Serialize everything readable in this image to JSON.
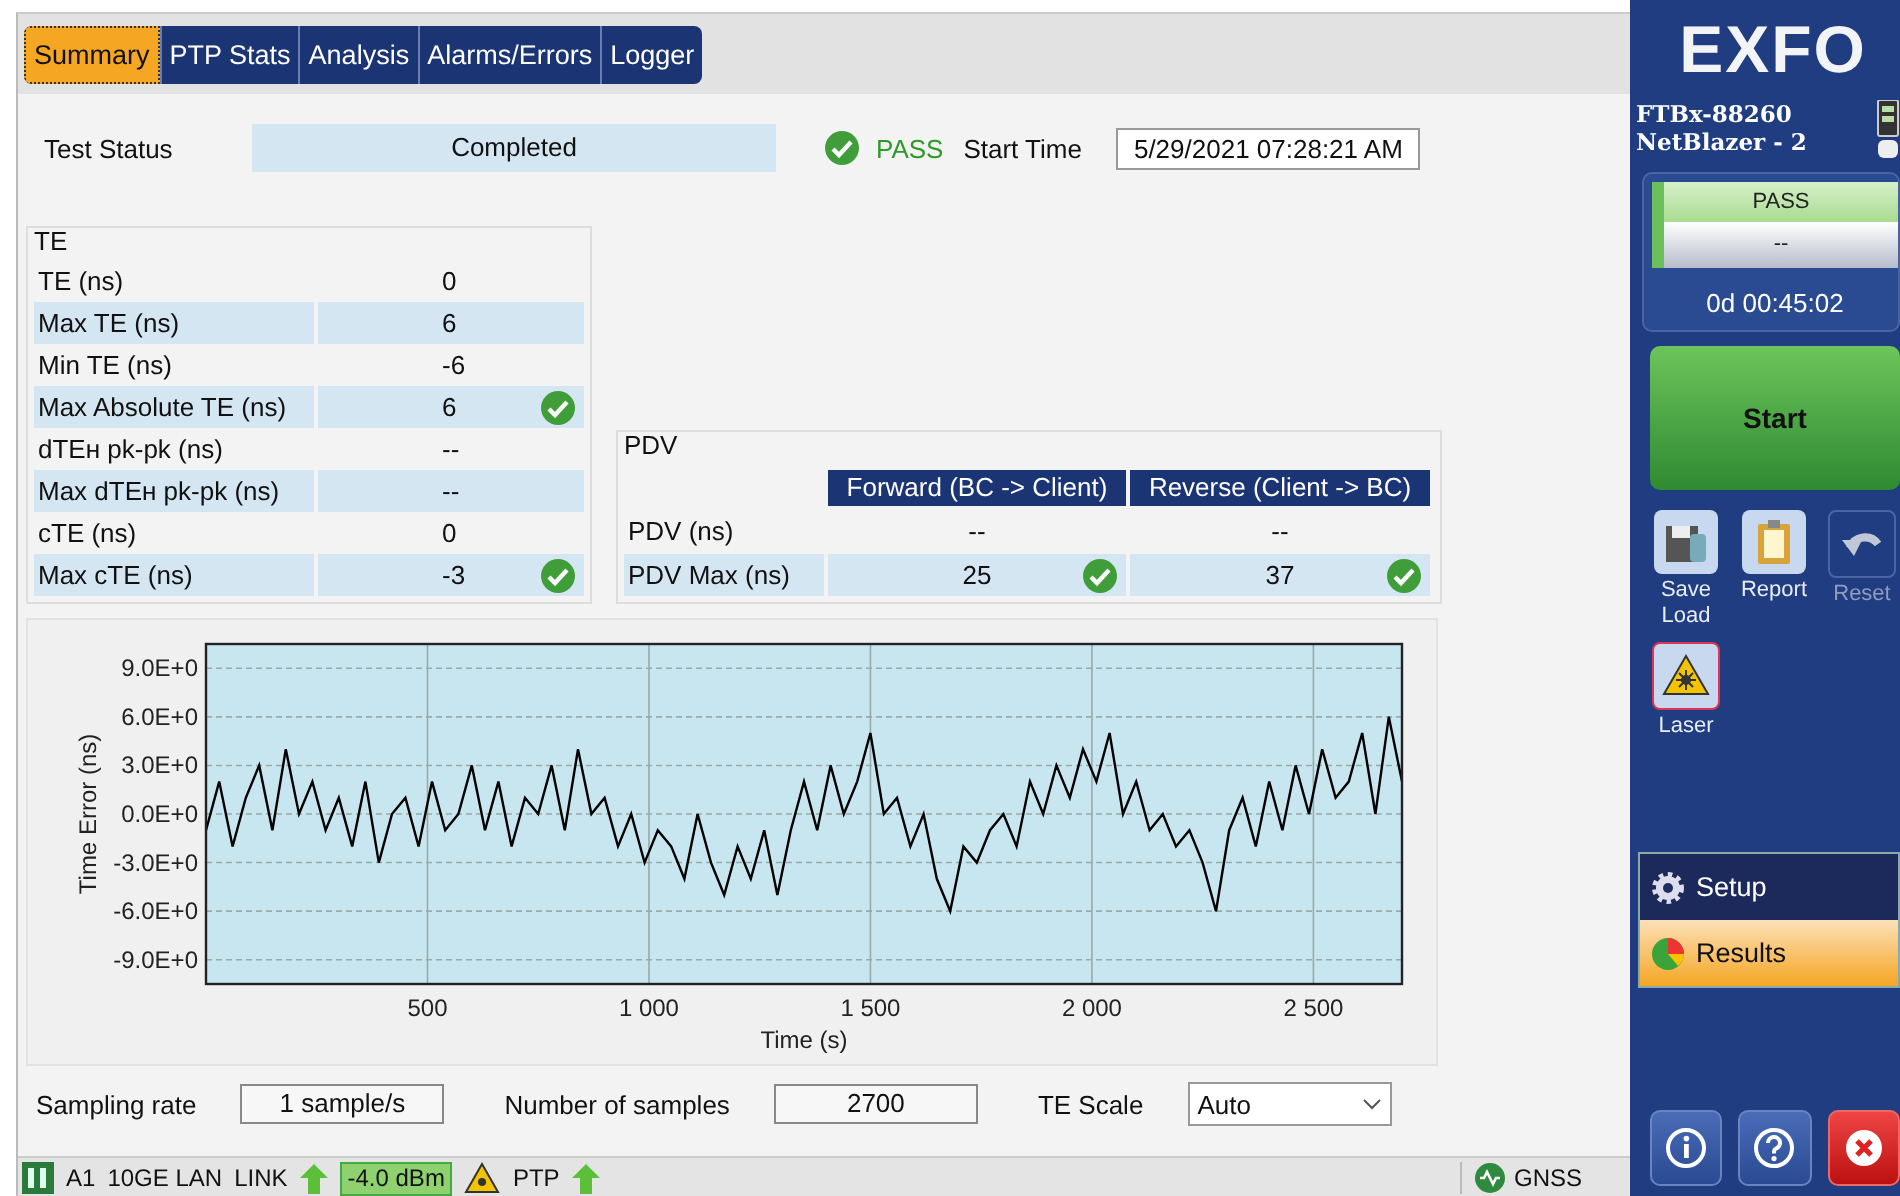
{
  "tabs": [
    {
      "label": "Summary",
      "selected": true
    },
    {
      "label": "PTP Stats",
      "selected": false
    },
    {
      "label": "Analysis",
      "selected": false
    },
    {
      "label": "Alarms/Errors",
      "selected": false
    },
    {
      "label": "Logger",
      "selected": false
    }
  ],
  "test_status": {
    "label": "Test Status",
    "value": "Completed",
    "verdict": "PASS",
    "pass": true,
    "start_time_label": "Start Time",
    "start_time": "5/29/2021 07:28:21 AM"
  },
  "te": {
    "title": "TE",
    "rows": [
      {
        "label": "TE (ns)",
        "value": "0",
        "pass": false
      },
      {
        "label": "Max TE (ns)",
        "value": "6",
        "pass": false
      },
      {
        "label": "Min TE (ns)",
        "value": "-6",
        "pass": false
      },
      {
        "label": "Max Absolute TE (ns)",
        "value": "6",
        "pass": true
      },
      {
        "label": "dTEʜ pk-pk (ns)",
        "value": "--",
        "pass": false
      },
      {
        "label": "Max dTEʜ pk-pk (ns)",
        "value": "--",
        "pass": false
      },
      {
        "label": "cTE (ns)",
        "value": "0",
        "pass": false
      },
      {
        "label": "Max cTE (ns)",
        "value": "-3",
        "pass": true
      }
    ]
  },
  "pdv": {
    "title": "PDV",
    "columns": [
      "Forward (BC -> Client)",
      "Reverse (Client -> BC)"
    ],
    "rows": [
      {
        "label": "PDV (ns)",
        "cells": [
          {
            "value": "--",
            "pass": false
          },
          {
            "value": "--",
            "pass": false
          }
        ]
      },
      {
        "label": "PDV Max (ns)",
        "cells": [
          {
            "value": "25",
            "pass": true
          },
          {
            "value": "37",
            "pass": true
          }
        ]
      }
    ]
  },
  "chart": {
    "chart_data": {
      "type": "line",
      "xlabel": "Time (s)",
      "ylabel": "Time Error (ns)",
      "xlim": [
        0,
        2700
      ],
      "ylim": [
        -10.5,
        10.5
      ],
      "xticks": [
        {
          "value": 500,
          "label": "500"
        },
        {
          "value": 1000,
          "label": "1 000"
        },
        {
          "value": 1500,
          "label": "1 500"
        },
        {
          "value": 2000,
          "label": "2 000"
        },
        {
          "value": 2500,
          "label": "2 500"
        }
      ],
      "yticks": [
        {
          "value": 9,
          "label": "9.0E+0"
        },
        {
          "value": 6,
          "label": "6.0E+0"
        },
        {
          "value": 3,
          "label": "3.0E+0"
        },
        {
          "value": 0,
          "label": "0.0E+0"
        },
        {
          "value": -3,
          "label": "-3.0E+0"
        },
        {
          "value": -6,
          "label": "-6.0E+0"
        },
        {
          "value": -9,
          "label": "-9.0E+0"
        }
      ],
      "x": [
        0,
        30,
        60,
        90,
        120,
        150,
        180,
        210,
        240,
        270,
        300,
        330,
        360,
        390,
        420,
        450,
        480,
        510,
        540,
        570,
        600,
        630,
        660,
        690,
        720,
        750,
        780,
        810,
        840,
        870,
        900,
        930,
        960,
        990,
        1020,
        1050,
        1080,
        1110,
        1140,
        1170,
        1200,
        1230,
        1260,
        1290,
        1320,
        1350,
        1380,
        1410,
        1440,
        1470,
        1500,
        1530,
        1560,
        1590,
        1620,
        1650,
        1680,
        1710,
        1740,
        1770,
        1800,
        1830,
        1860,
        1890,
        1920,
        1950,
        1980,
        2010,
        2040,
        2070,
        2100,
        2130,
        2160,
        2190,
        2220,
        2250,
        2280,
        2310,
        2340,
        2370,
        2400,
        2430,
        2460,
        2490,
        2520,
        2550,
        2580,
        2610,
        2640,
        2670,
        2700
      ],
      "grid": true,
      "series": [
        {
          "color": "#000000",
          "values": [
            -1,
            2,
            -2,
            1,
            3,
            -1,
            4,
            0,
            2,
            -1,
            1,
            -2,
            2,
            -3,
            0,
            1,
            -2,
            2,
            -1,
            0,
            3,
            -1,
            2,
            -2,
            1,
            0,
            3,
            -1,
            4,
            0,
            1,
            -2,
            0,
            -3,
            -1,
            -2,
            -4,
            0,
            -3,
            -5,
            -2,
            -4,
            -1,
            -5,
            -1,
            2,
            -1,
            3,
            0,
            2,
            5,
            0,
            1,
            -2,
            0,
            -4,
            -6,
            -2,
            -3,
            -1,
            0,
            -2,
            2,
            0,
            3,
            1,
            4,
            2,
            5,
            0,
            2,
            -1,
            0,
            -2,
            -1,
            -3,
            -6,
            -1,
            1,
            -2,
            2,
            -1,
            3,
            0,
            4,
            1,
            2,
            5,
            0,
            6,
            2
          ]
        }
      ]
    }
  },
  "controls": {
    "sampling_label": "Sampling rate",
    "sampling": "1 sample/s",
    "samples_label": "Number of samples",
    "samples": "2700",
    "scale_label": "TE Scale",
    "scale": "Auto"
  },
  "status_bar": {
    "items": [
      {
        "kind": "text",
        "text": "A1"
      },
      {
        "kind": "text",
        "text": "10GE LAN"
      },
      {
        "kind": "link",
        "text": "LINK",
        "up": true
      },
      {
        "kind": "power",
        "text": "-4.0 dBm"
      },
      {
        "kind": "laser"
      },
      {
        "kind": "link",
        "text": "PTP",
        "up": true
      }
    ],
    "gnss": "GNSS"
  },
  "sidebar": {
    "logo": "EXFO",
    "device": [
      "FTBx-88260",
      "NetBlazer - 2"
    ],
    "status": {
      "verdict": "PASS",
      "value": "--",
      "elapsed": "0d 00:45:02"
    },
    "start": "Start",
    "tools": [
      {
        "kind": "save",
        "label": "Save Load",
        "disabled": false
      },
      {
        "kind": "report",
        "label": "Report",
        "disabled": false
      },
      {
        "kind": "reset",
        "label": "Reset",
        "disabled": true
      },
      {
        "kind": "laser",
        "label": "Laser",
        "disabled": false
      }
    ],
    "nav": [
      {
        "kind": "setup",
        "label": "Setup",
        "selected": false
      },
      {
        "kind": "results",
        "label": "Results",
        "selected": true
      }
    ],
    "footer": [
      {
        "kind": "info"
      },
      {
        "kind": "help"
      },
      {
        "kind": "exit"
      }
    ]
  }
}
